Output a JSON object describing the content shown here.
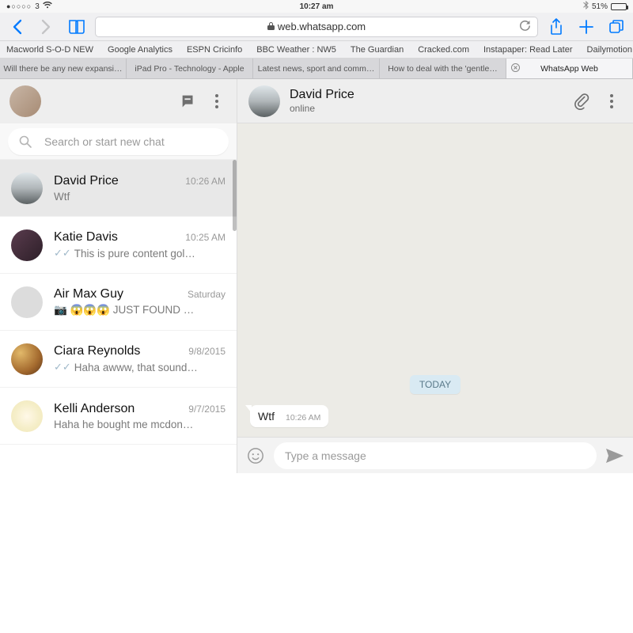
{
  "statusbar": {
    "signal": "●○○○○",
    "carrier": "3",
    "wifi": true,
    "time": "10:27 am",
    "bt": true,
    "battery_pct": "51%",
    "battery_fill_pct": 51
  },
  "toolbar": {
    "url": "web.whatsapp.com"
  },
  "bookmarks": [
    "Macworld S-O-D NEW",
    "Google Analytics",
    "ESPN Cricinfo",
    "BBC Weather : NW5",
    "The Guardian",
    "Cracked.com",
    "Instapaper: Read Later",
    "Dailymotion"
  ],
  "tabs": [
    {
      "label": "Will there be any new expansi…",
      "active": false
    },
    {
      "label": "iPad Pro - Technology - Apple",
      "active": false
    },
    {
      "label": "Latest news, sport and comm…",
      "active": false
    },
    {
      "label": "How to deal with the 'gentle…",
      "active": false
    },
    {
      "label": "WhatsApp Web",
      "active": true
    }
  ],
  "wa": {
    "search_placeholder": "Search or start new chat",
    "chats": [
      {
        "name": "David Price",
        "time": "10:26 AM",
        "preview": "Wtf",
        "ticks": false,
        "selected": true,
        "avatar": "av-david"
      },
      {
        "name": "Katie Davis",
        "time": "10:25 AM",
        "preview": "This is pure content gol…",
        "ticks": true,
        "selected": false,
        "avatar": "av-gradient2"
      },
      {
        "name": "Air Max Guy",
        "time": "Saturday",
        "preview": "📷 😱😱😱 JUST FOUND …",
        "ticks": false,
        "selected": false,
        "avatar": "av-gradient3"
      },
      {
        "name": "Ciara Reynolds",
        "time": "9/8/2015",
        "preview": "Haha awww, that sound…",
        "ticks": true,
        "selected": false,
        "avatar": "av-gradient4"
      },
      {
        "name": "Kelli Anderson",
        "time": "9/7/2015",
        "preview": "Haha he bought me mcdon…",
        "ticks": false,
        "selected": false,
        "avatar": "av-gradient5"
      }
    ],
    "active_chat": {
      "name": "David Price",
      "status": "online",
      "day_label": "TODAY",
      "message_text": "Wtf",
      "message_time": "10:26 AM"
    },
    "composer_placeholder": "Type a message"
  }
}
